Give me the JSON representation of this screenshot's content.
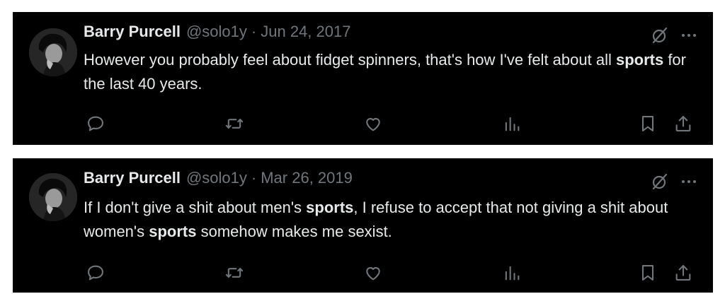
{
  "tweets": [
    {
      "author_name": "Barry Purcell",
      "handle": "@solo1y",
      "separator": "·",
      "date": "Jun 24, 2017",
      "text_parts": [
        {
          "text": "However you probably feel about fidget spinners, that's how I've felt about all ",
          "bold": false
        },
        {
          "text": "sports",
          "bold": true
        },
        {
          "text": " for the last 40 years.",
          "bold": false
        }
      ]
    },
    {
      "author_name": "Barry Purcell",
      "handle": "@solo1y",
      "separator": "·",
      "date": "Mar 26, 2019",
      "text_parts": [
        {
          "text": "If I don't give a shit about men's ",
          "bold": false
        },
        {
          "text": "sports",
          "bold": true
        },
        {
          "text": ", I refuse to accept that not giving a shit about women's ",
          "bold": false
        },
        {
          "text": "sports",
          "bold": true
        },
        {
          "text": " somehow makes me sexist.",
          "bold": false
        }
      ]
    }
  ],
  "icons": {
    "top": [
      "grok-icon",
      "more-icon"
    ],
    "actions": [
      "reply-icon",
      "retweet-icon",
      "like-icon",
      "views-icon",
      "bookmark-icon",
      "share-icon"
    ]
  },
  "colors": {
    "card_bg": "#000000",
    "page_bg": "#ffffff",
    "primary_text": "#e7e9ea",
    "secondary_text": "#71767b"
  }
}
